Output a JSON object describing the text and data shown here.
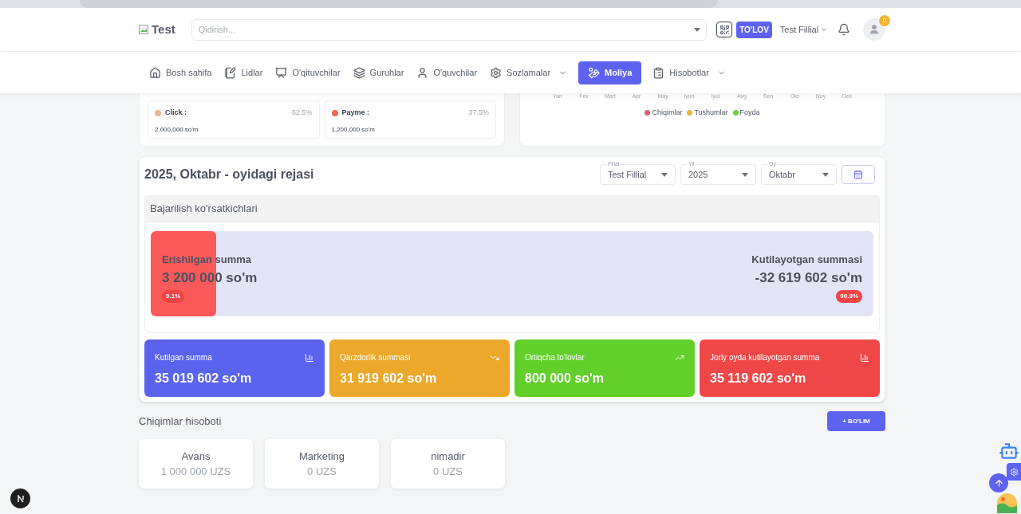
{
  "header": {
    "logo": "Test",
    "search": {
      "placeholder": "Qidirish..."
    },
    "pay_button": "TO'LOV",
    "branch": "Test Fillial",
    "avatar_badge": "0"
  },
  "nav": [
    {
      "label": "Bosh sahifa",
      "selected": false,
      "dropdown": false
    },
    {
      "label": "Lidlar",
      "selected": false,
      "dropdown": false
    },
    {
      "label": "O'qituvchilar",
      "selected": false,
      "dropdown": false
    },
    {
      "label": "Guruhlar",
      "selected": false,
      "dropdown": false
    },
    {
      "label": "O'quvchilar",
      "selected": false,
      "dropdown": false
    },
    {
      "label": "Sozlamalar",
      "selected": false,
      "dropdown": true
    },
    {
      "label": "Moliya",
      "selected": true,
      "dropdown": false
    },
    {
      "label": "Hisobotlar",
      "selected": false,
      "dropdown": true
    }
  ],
  "payments": [
    {
      "name": "Click :",
      "percent": "62.5%",
      "amount": "2,000,000 so'm",
      "color": "#e8b590"
    },
    {
      "name": "Payme :",
      "percent": "37.5%",
      "amount": "1,200,000 so'm",
      "color": "#ec6a50"
    }
  ],
  "chart": {
    "months": [
      "Yan",
      "Fev",
      "Mart",
      "Apr",
      "May",
      "Iyun",
      "Iyul",
      "Avg",
      "Sen",
      "Okt",
      "Noy",
      "Dek"
    ],
    "legend": [
      {
        "label": "Chiqimlar",
        "color": "#e8586a"
      },
      {
        "label": "Tushumlar",
        "color": "#f0b43c"
      },
      {
        "label": "Foyda",
        "color": "#6ad03a"
      }
    ]
  },
  "plan": {
    "title": "2025, Oktabr - oyidagi rejasi",
    "filters": [
      {
        "label": "Filial",
        "value": "Test Fillial"
      },
      {
        "label": "Yil",
        "value": "2025"
      },
      {
        "label": "Oy",
        "value": "Oktabr"
      }
    ],
    "indicators_title": "Bajarilish ko'rsatkichlari",
    "achieved": {
      "label": "Erishilgan summa",
      "value": "3 200 000 so'm",
      "percent": "9.1%"
    },
    "expected": {
      "label": "Kutilayotgan summasi",
      "value": "-32 619 602 so'm",
      "percent": "90.9%"
    },
    "level": 0.091
  },
  "stats": [
    {
      "label": "Kutilgan summa",
      "value": "35 019 602 so'm",
      "color": "#5a63ee"
    },
    {
      "label": "Qarzdorlik summasi",
      "value": "31 919 602 so'm",
      "color": "#eca82a"
    },
    {
      "label": "Ortiqcha to'lovlar",
      "value": "800 000 so'm",
      "color": "#62cf2b"
    },
    {
      "label": "Joriy oyda kutilayotgan summa",
      "value": "35 119 602 so'm",
      "color": "#ef4747"
    }
  ],
  "expenses": {
    "title": "Chiqimlar hisoboti",
    "add_button": "+ BO'LIM",
    "items": [
      {
        "name": "Avans",
        "amount": "1 000 000 UZS"
      },
      {
        "name": "Marketing",
        "amount": "0 UZS"
      },
      {
        "name": "nimadir",
        "amount": "0 UZS"
      }
    ]
  }
}
